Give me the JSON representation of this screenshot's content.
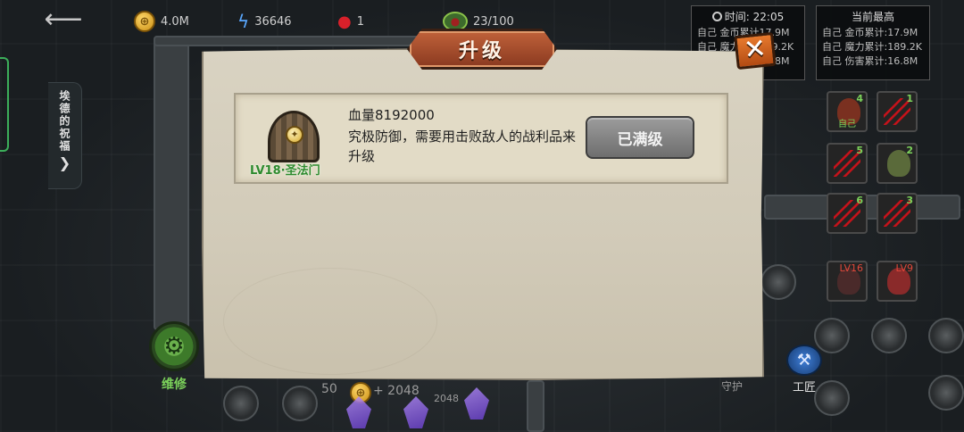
{
  "hud": {
    "back_label": "⟵",
    "gold": "4.0M",
    "mana": "36646",
    "blood": "1",
    "capacity": "23/100"
  },
  "stats_panel": {
    "time_label": "时间:",
    "time_value": "22:05",
    "rows": [
      "自己 金币累计17.9M",
      "自己 魔力累计189.2K",
      "自己 伤害累计16.8M"
    ]
  },
  "best_panel": {
    "title": "当前最高",
    "rows": [
      "自己 金币累计:17.9M",
      "自己 魔力累计:189.2K",
      "自己 伤害累计:16.8M"
    ]
  },
  "blessing_tab": {
    "label": "埃德的祝福",
    "arrow": "❯"
  },
  "hero_slots": [
    {
      "num": "4",
      "label": "自己",
      "kind": "face",
      "color": "#7a3020"
    },
    {
      "num": "1",
      "label": "",
      "kind": "claw"
    },
    {
      "num": "5",
      "label": "",
      "kind": "claw"
    },
    {
      "num": "2",
      "label": "",
      "kind": "face",
      "color": "#5a6a3a"
    },
    {
      "num": "6",
      "label": "",
      "kind": "claw"
    },
    {
      "num": "3",
      "label": "",
      "kind": "claw"
    }
  ],
  "enemy_slots": [
    {
      "level": "LV16"
    },
    {
      "level": "LV9"
    }
  ],
  "bottom": {
    "repair_label": "维修",
    "repair_icon": "⚙",
    "count_50": "50",
    "income": "+ 2048",
    "income_small": "2048",
    "craft_label": "工匠",
    "guard_label": "守护"
  },
  "dialog": {
    "title": "升级",
    "close_label": "✕",
    "item": {
      "name": "LV18·圣法门",
      "hp": "血量8192000",
      "description": "究极防御，需要用击败敌人的战利品来升级",
      "button_label": "已满级"
    }
  },
  "colors": {
    "accent_green": "#7cd35b",
    "title_plate": "#b4562f",
    "close_orange": "#e0702a"
  }
}
